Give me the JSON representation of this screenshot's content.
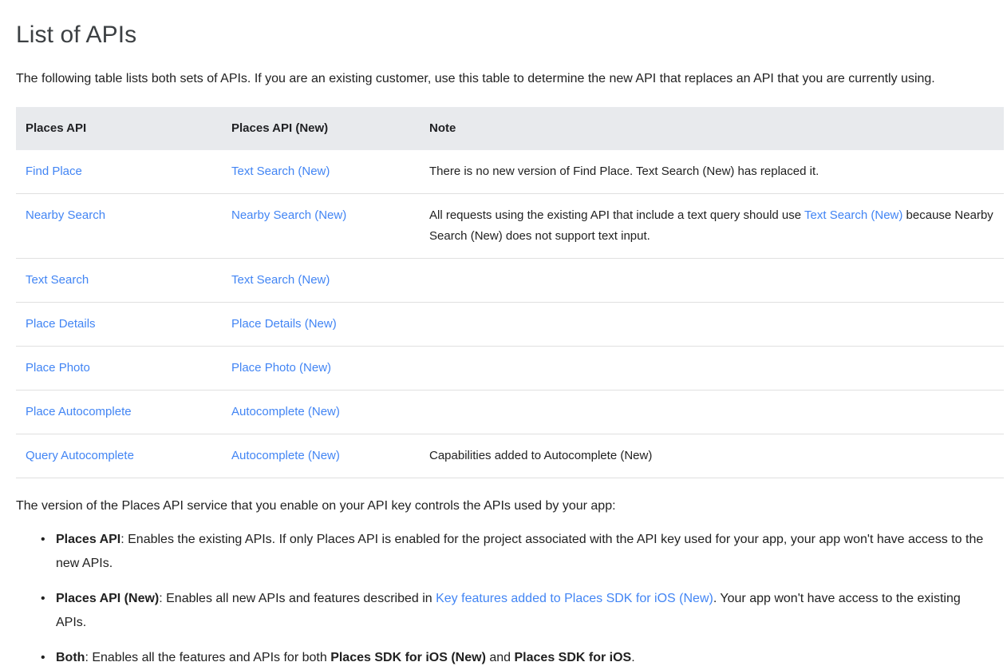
{
  "page": {
    "title": "List of APIs",
    "intro": "The following table lists both sets of APIs. If you are an existing customer, use this table to determine the new API that replaces an API that you are currently using.",
    "after_table": "The version of the Places API service that you enable on your API key controls the APIs used by your app:"
  },
  "colors": {
    "link": "#4285f4",
    "header_bg": "#e8eaed",
    "text": "#212121",
    "heading": "#3c4043",
    "row_border": "#e0e0e0"
  },
  "table": {
    "headers": [
      "Places API",
      "Places API (New)",
      "Note"
    ],
    "rows": [
      {
        "old_api": "Find Place",
        "new_api": "Text Search (New)",
        "note_before": "There is no new version of Find Place. Text Search (New) has replaced it.",
        "note_link": "",
        "note_after": ""
      },
      {
        "old_api": "Nearby Search",
        "new_api": "Nearby Search (New)",
        "note_before": "All requests using the existing API that include a text query should use ",
        "note_link": "Text Search (New)",
        "note_after": " because Nearby Search (New) does not support text input."
      },
      {
        "old_api": "Text Search",
        "new_api": "Text Search (New)",
        "note_before": "",
        "note_link": "",
        "note_after": ""
      },
      {
        "old_api": "Place Details",
        "new_api": "Place Details (New)",
        "note_before": "",
        "note_link": "",
        "note_after": ""
      },
      {
        "old_api": "Place Photo",
        "new_api": "Place Photo (New)",
        "note_before": "",
        "note_link": "",
        "note_after": ""
      },
      {
        "old_api": "Place Autocomplete",
        "new_api": "Autocomplete (New)",
        "note_before": "",
        "note_link": "",
        "note_after": ""
      },
      {
        "old_api": "Query Autocomplete",
        "new_api": "Autocomplete (New)",
        "note_before": "Capabilities added to Autocomplete (New)",
        "note_link": "",
        "note_after": ""
      }
    ]
  },
  "bullets": [
    {
      "term": "Places API",
      "text_before": ": Enables the existing APIs. If only Places API is enabled for the project associated with the API key used for your app, your app won't have access to the new APIs.",
      "link": "",
      "text_after": "",
      "term2": "",
      "text_mid": "",
      "term3": "",
      "text_end": ""
    },
    {
      "term": "Places API (New)",
      "text_before": ": Enables all new APIs and features described in ",
      "link": "Key features added to Places SDK for iOS (New)",
      "text_after": ". Your app won't have access to the existing APIs.",
      "term2": "",
      "text_mid": "",
      "term3": "",
      "text_end": ""
    },
    {
      "term": "Both",
      "text_before": ": Enables all the features and APIs for both ",
      "link": "",
      "text_after": "",
      "term2": "Places SDK for iOS (New)",
      "text_mid": " and ",
      "term3": "Places SDK for iOS",
      "text_end": "."
    }
  ]
}
